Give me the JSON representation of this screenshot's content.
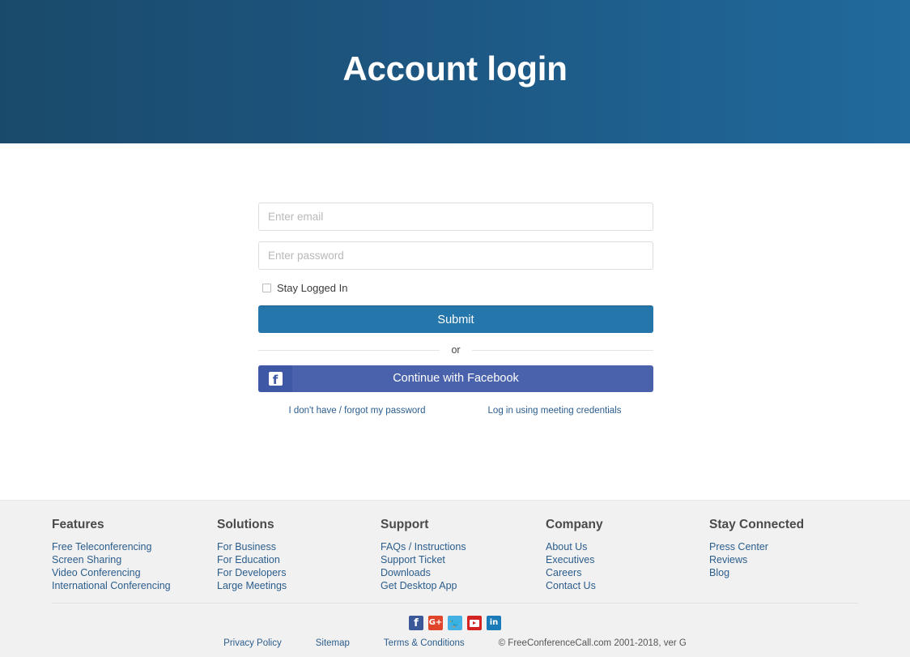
{
  "hero": {
    "title": "Account login",
    "gradient_start": "#1a4a6b",
    "gradient_end": "#206a9c"
  },
  "login_form": {
    "email_placeholder": "Enter email",
    "email_value": "",
    "password_placeholder": "Enter password",
    "password_value": "",
    "stay_logged_in_label": "Stay Logged In",
    "stay_logged_in_checked": false,
    "submit_label": "Submit",
    "submit_color": "#2476ab",
    "divider_label": "or",
    "facebook_label": "Continue with Facebook",
    "facebook_color": "#4a62ab",
    "forgot_password_link": "I don't have / forgot my password",
    "meeting_credentials_link": "Log in using meeting credentials",
    "link_color": "#2b5d8c"
  },
  "footer": {
    "background": "#f1f1f1",
    "columns": [
      {
        "heading": "Features",
        "links": [
          "Free Teleconferencing",
          "Screen Sharing",
          "Video Conferencing",
          "International Conferencing"
        ]
      },
      {
        "heading": "Solutions",
        "links": [
          "For Business",
          "For Education",
          "For Developers",
          "Large Meetings"
        ]
      },
      {
        "heading": "Support",
        "links": [
          "FAQs / Instructions",
          "Support Ticket",
          "Downloads",
          "Get Desktop App"
        ]
      },
      {
        "heading": "Company",
        "links": [
          "About Us",
          "Executives",
          "Careers",
          "Contact Us"
        ]
      },
      {
        "heading": "Stay Connected",
        "links": [
          "Press Center",
          "Reviews",
          "Blog"
        ]
      }
    ],
    "social": [
      {
        "name": "facebook-icon",
        "glyph": "f",
        "color": "#3b5998"
      },
      {
        "name": "googleplus-icon",
        "glyph": "G+",
        "color": "#e0452c"
      },
      {
        "name": "twitter-icon",
        "glyph": "ᵗ",
        "color": "#45b0e3"
      },
      {
        "name": "youtube-icon",
        "glyph": "",
        "color": "#d32323"
      },
      {
        "name": "linkedin-icon",
        "glyph": "in",
        "color": "#1b7bb9"
      }
    ],
    "bottom_links": [
      "Privacy Policy",
      "Sitemap",
      "Terms & Conditions"
    ],
    "copyright": "© FreeConferenceCall.com 2001-2018, ver G"
  }
}
